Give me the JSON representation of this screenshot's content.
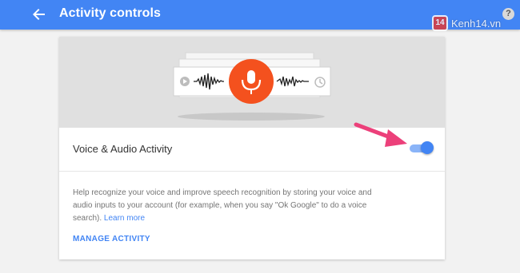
{
  "header": {
    "title": "Activity controls",
    "back_icon": "arrow-back-icon",
    "help_icon_glyph": "?"
  },
  "watermark": {
    "badge": "14",
    "text": "Kenh14.vn"
  },
  "card": {
    "setting_label": "Voice & Audio Activity",
    "toggle_on": true,
    "description_text": "Help recognize your voice and improve speech recognition by storing your voice and audio inputs to your account (for example, when you say \"Ok Google\" to do a voice search).",
    "learn_more_label": "Learn more",
    "manage_label": "MANAGE ACTIVITY"
  },
  "colors": {
    "primary": "#4285f4",
    "mic_orange": "#f4511e",
    "annotation_arrow": "#ec407a",
    "page_bg": "#f2f2f2"
  },
  "icons": {
    "mic": "microphone-icon",
    "play": "play-icon",
    "clock": "clock-icon"
  }
}
